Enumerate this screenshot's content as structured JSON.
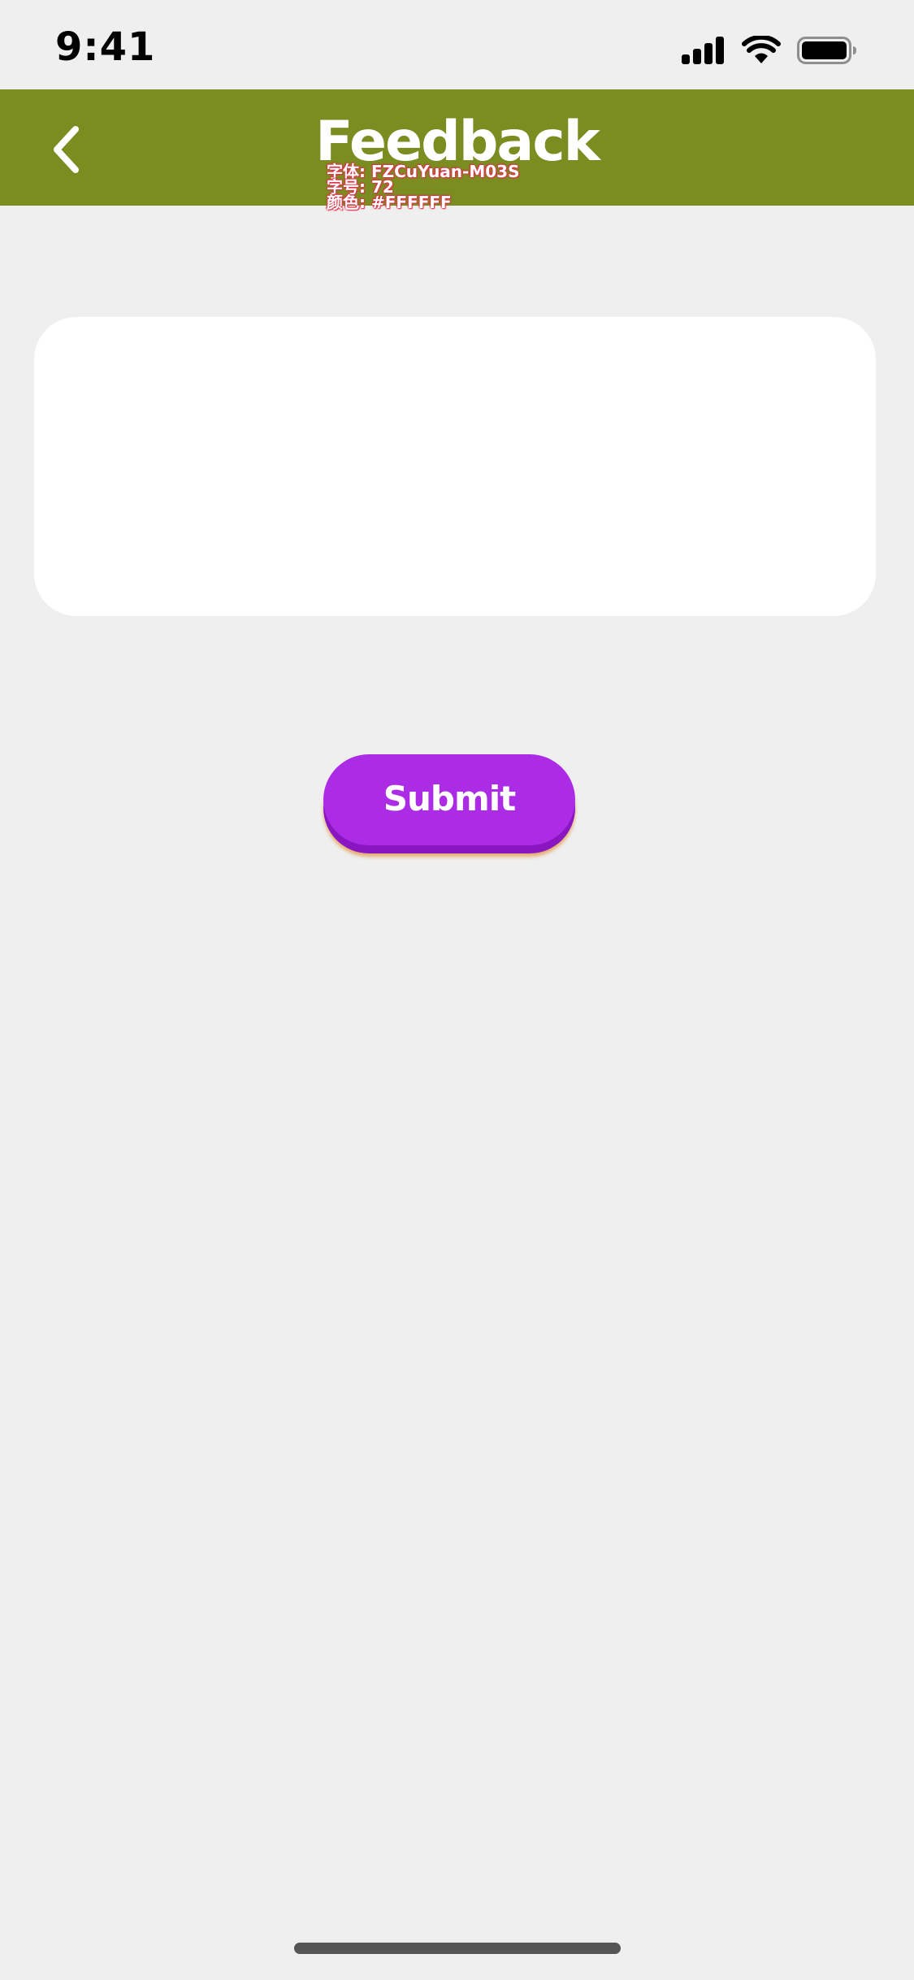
{
  "status_bar": {
    "time": "9:41",
    "icons": [
      "cellular-signal-icon",
      "wifi-icon",
      "battery-icon"
    ]
  },
  "nav": {
    "back_icon": "chevron-left-icon",
    "title": "Feedback",
    "annotation": {
      "font_line": "字体: FZCuYuan-M03S",
      "size_line": "字号: 72",
      "color_line": "颜色: #FFFFFF"
    }
  },
  "feedback": {
    "value": "",
    "placeholder": ""
  },
  "submit": {
    "label": "Submit"
  },
  "colors": {
    "background": "#efefef",
    "nav_bar": "#7b8c20",
    "submit_button": "#ac2ce6",
    "submit_shadow": "#8a16c2",
    "text_on_color": "#ffffff",
    "annotation_outline": "#e0304a"
  }
}
